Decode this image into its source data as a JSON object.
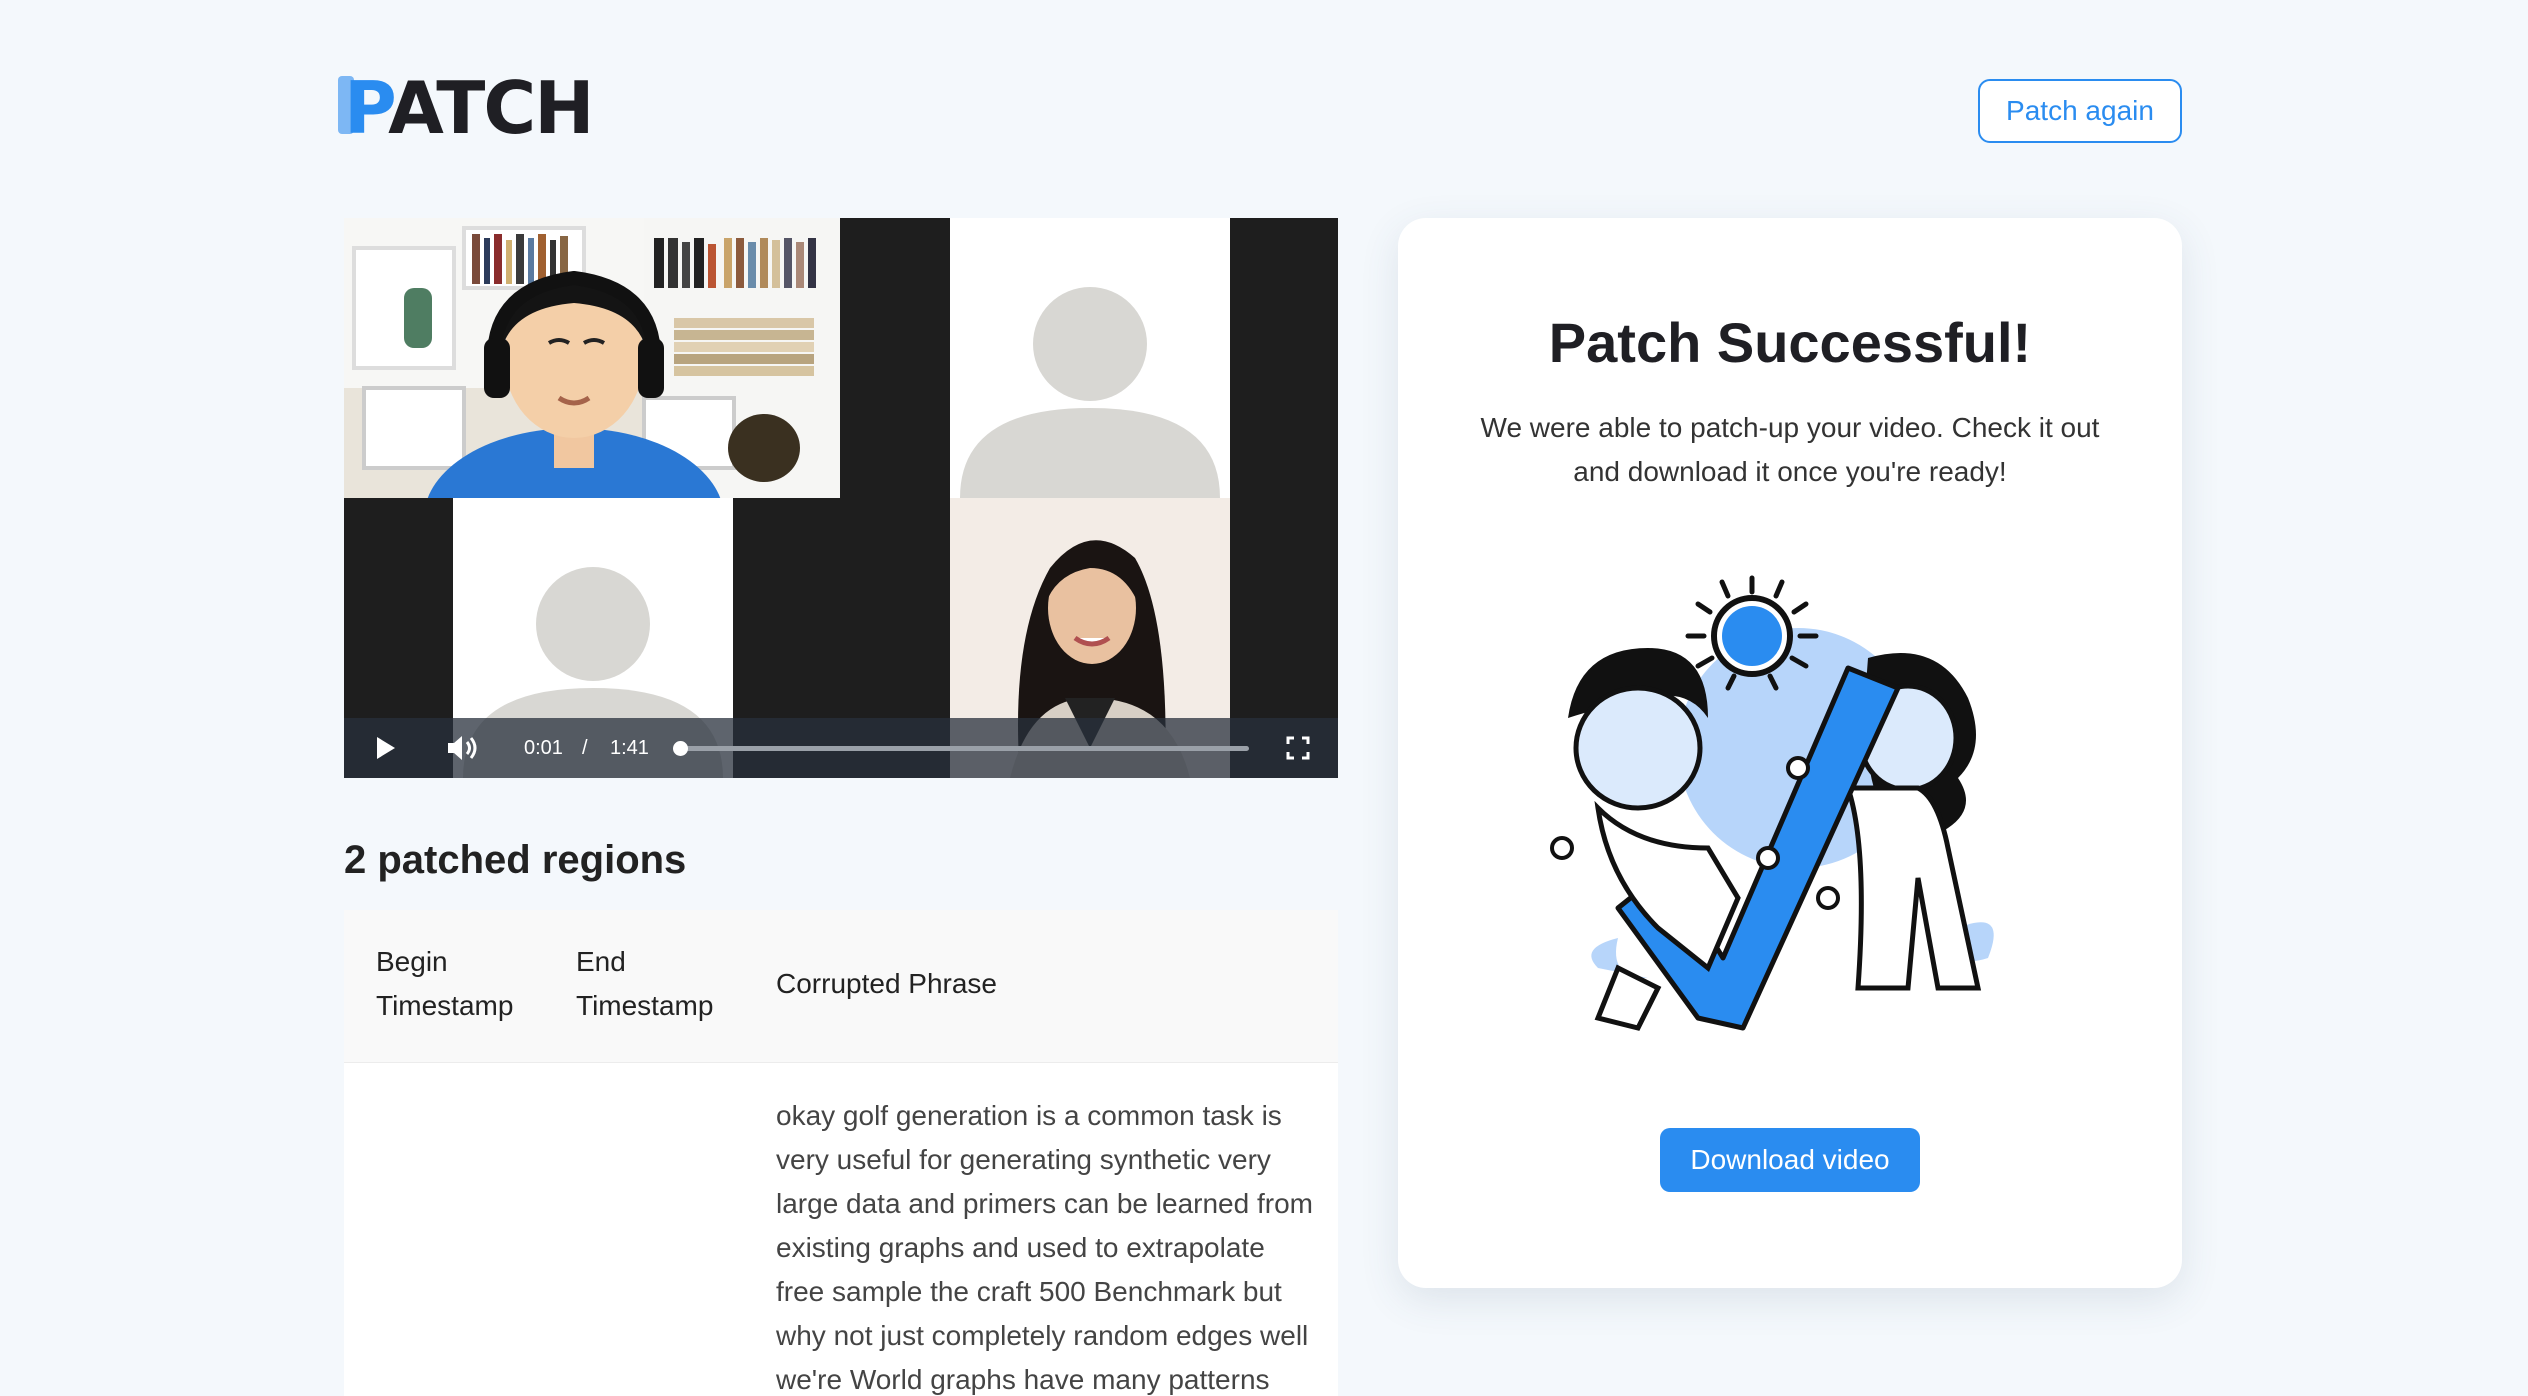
{
  "header": {
    "logo_text": "PATCH",
    "patch_again_label": "Patch again"
  },
  "video": {
    "current_time": "0:01",
    "separator": "/",
    "duration": "1:41",
    "progress_fraction": 0.01
  },
  "regions": {
    "title": "2 patched regions",
    "columns": [
      "Begin Timestamp",
      "End Timestamp",
      "Corrupted Phrase"
    ],
    "rows": [
      {
        "begin": "",
        "end": "",
        "phrase": "okay golf generation is a common task is very useful for generating synthetic very large data and primers can be learned from existing graphs and used to extrapolate free sample the craft 500 Benchmark but why not just completely random edges well we're World graphs have many patterns"
      }
    ]
  },
  "card": {
    "title": "Patch Successful!",
    "subtitle": "We were able to patch-up your video. Check it out and download it once you're ready!",
    "download_label": "Download video"
  },
  "colors": {
    "accent": "#2a8cf0",
    "background": "#f4f8fc",
    "illustration_light": "#b7d5fa"
  }
}
